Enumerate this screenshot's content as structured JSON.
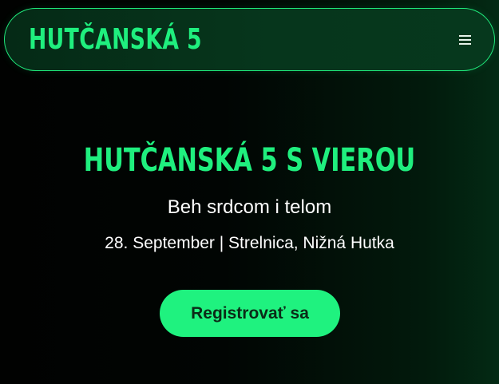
{
  "nav": {
    "brand": "HUTČANSKÁ 5",
    "menu_icon": "hamburger-menu-icon"
  },
  "hero": {
    "title": "HUTČANSKÁ 5 S VIEROU",
    "subtitle": "Beh srdcom i telom",
    "details": "28. September | Strelnica, Nižná Hutka",
    "cta_label": "Registrovať sa"
  },
  "colors": {
    "accent": "#1fef7e",
    "button_text": "#0b2a17",
    "nav_background": "#06361c",
    "page_background": "#010201"
  }
}
